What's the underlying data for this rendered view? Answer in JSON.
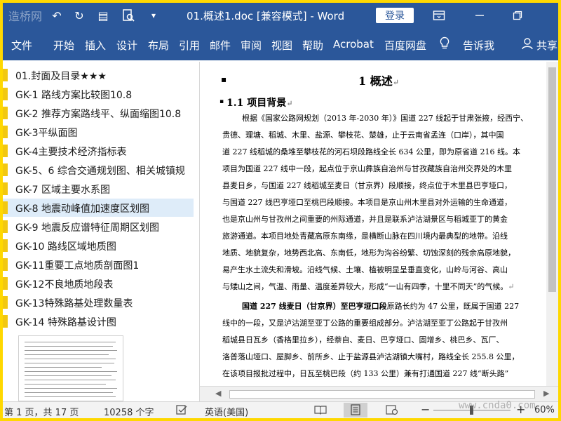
{
  "titlebar": {
    "title": "01.概述1.doc [兼容模式] - Word",
    "login_label": "登录",
    "watermark": "造桥网"
  },
  "menubar": {
    "items": [
      "文件",
      "开始",
      "插入",
      "设计",
      "布局",
      "引用",
      "邮件",
      "审阅",
      "视图",
      "帮助",
      "Acrobat",
      "百度网盘",
      "告诉我",
      "共享"
    ]
  },
  "nav": {
    "items": [
      "01.封面及目录★★★",
      "GK-1 路线方案比较图10.8",
      "GK-2 推荐方案路线平、纵面缩图10.8",
      "GK-3平纵面图",
      "GK-4主要技术经济指标表",
      "GK-5、6 综合交通规划图、相关城镇规",
      "GK-7 区域主要水系图",
      "GK-8 地震动峰值加速度区划图",
      "GK-9 地震反应谱特征周期区划图",
      "GK-10 路线区域地质图",
      "GK-11重要工点地质剖面图1",
      "GK-12不良地质地段表",
      "GK-13特殊路基处理数量表",
      "GK-14 特殊路基设计图"
    ],
    "selected_index": 7
  },
  "document": {
    "heading1": "1  概述",
    "heading2": "1.1  项目背景",
    "paragraph1": [
      "根据《国家公路网规划（2013 年-2030 年）》国道 227 线起于甘肃张掖，经西宁、",
      "贵德、理塘、稻城、木里、盐源、攀枝花、楚雄，止于云南省孟连（口岸），其中国",
      "道 227 线稻城的桑堆至攀枝花的河石坝段路线全长 634 公里，即为原省道 216 线。本",
      "项目为国道 227 线中一段，起点位于京山彝族自治州与甘孜藏族自治州交界处的木里",
      "县麦日乡，与国道 227 线稻城至麦日（甘京界）段顺接，终点位于木里县巴亨垭口，",
      "与国道 227 线巴亨垭口至桃巴段顺接。本项目是京山州木里县对外运输的生命通道，",
      "也是京山州与甘孜州之间重要的州际通道，并且是联系泸沽湖景区与稻城亚丁的黄金",
      "旅游通道。本项目地处青藏高原东南缘，是横断山脉在四川境内最典型的地带。沿线",
      "地质、地貌复杂，地势西北高、东南低，地形为沟谷纷繁、切蚀深刻的残余高原地貌，",
      "易产生水土流失和滑坡。沿线气候、土壤、植被明显呈垂直变化，山岭与河谷、高山",
      "与矮山之间，气温、雨量、温度差异较大，形成“一山有四季，十里不同天”的气候。"
    ],
    "paragraph2_bold": "国道 227 线麦日（甘京界）至巴亨垭口段",
    "paragraph2": [
      "原路长约为 47 公里，既属于国道 227",
      "线中的一段，又是泸沽湖至亚丁公路的重要组成部分。泸沽湖至亚丁公路起于甘孜州",
      "稻城县日瓦乡（香格里拉乡），经萘自、麦日、巴亨垭口、固增乡、桃巴乡、瓦厂、",
      "洛普落山垭口、屋脚乡、前所乡、止于盐源县泸沽湖镇大嘴村，路线全长 255.8 公里，",
      "在该项目报批过程中，日瓦至桃巴段（约 133 公里）兼有打通国道 227 线“断头路”"
    ]
  },
  "statusbar": {
    "page": "第 1 页，共 17 页",
    "words": "10258 个字",
    "language": "英语(美国)",
    "zoom": "60%",
    "watermark": "www.cnda0.com"
  },
  "icons": {
    "save": "save-icon",
    "undo": "undo-icon",
    "redo": "redo-icon",
    "print_preview": "print-preview-icon",
    "customize": "customize-icon",
    "ribbon_display": "ribbon-display-icon",
    "minimize": "minimize-icon",
    "restore": "restore-icon",
    "lightbulb": "lightbulb-icon",
    "person": "person-icon"
  }
}
